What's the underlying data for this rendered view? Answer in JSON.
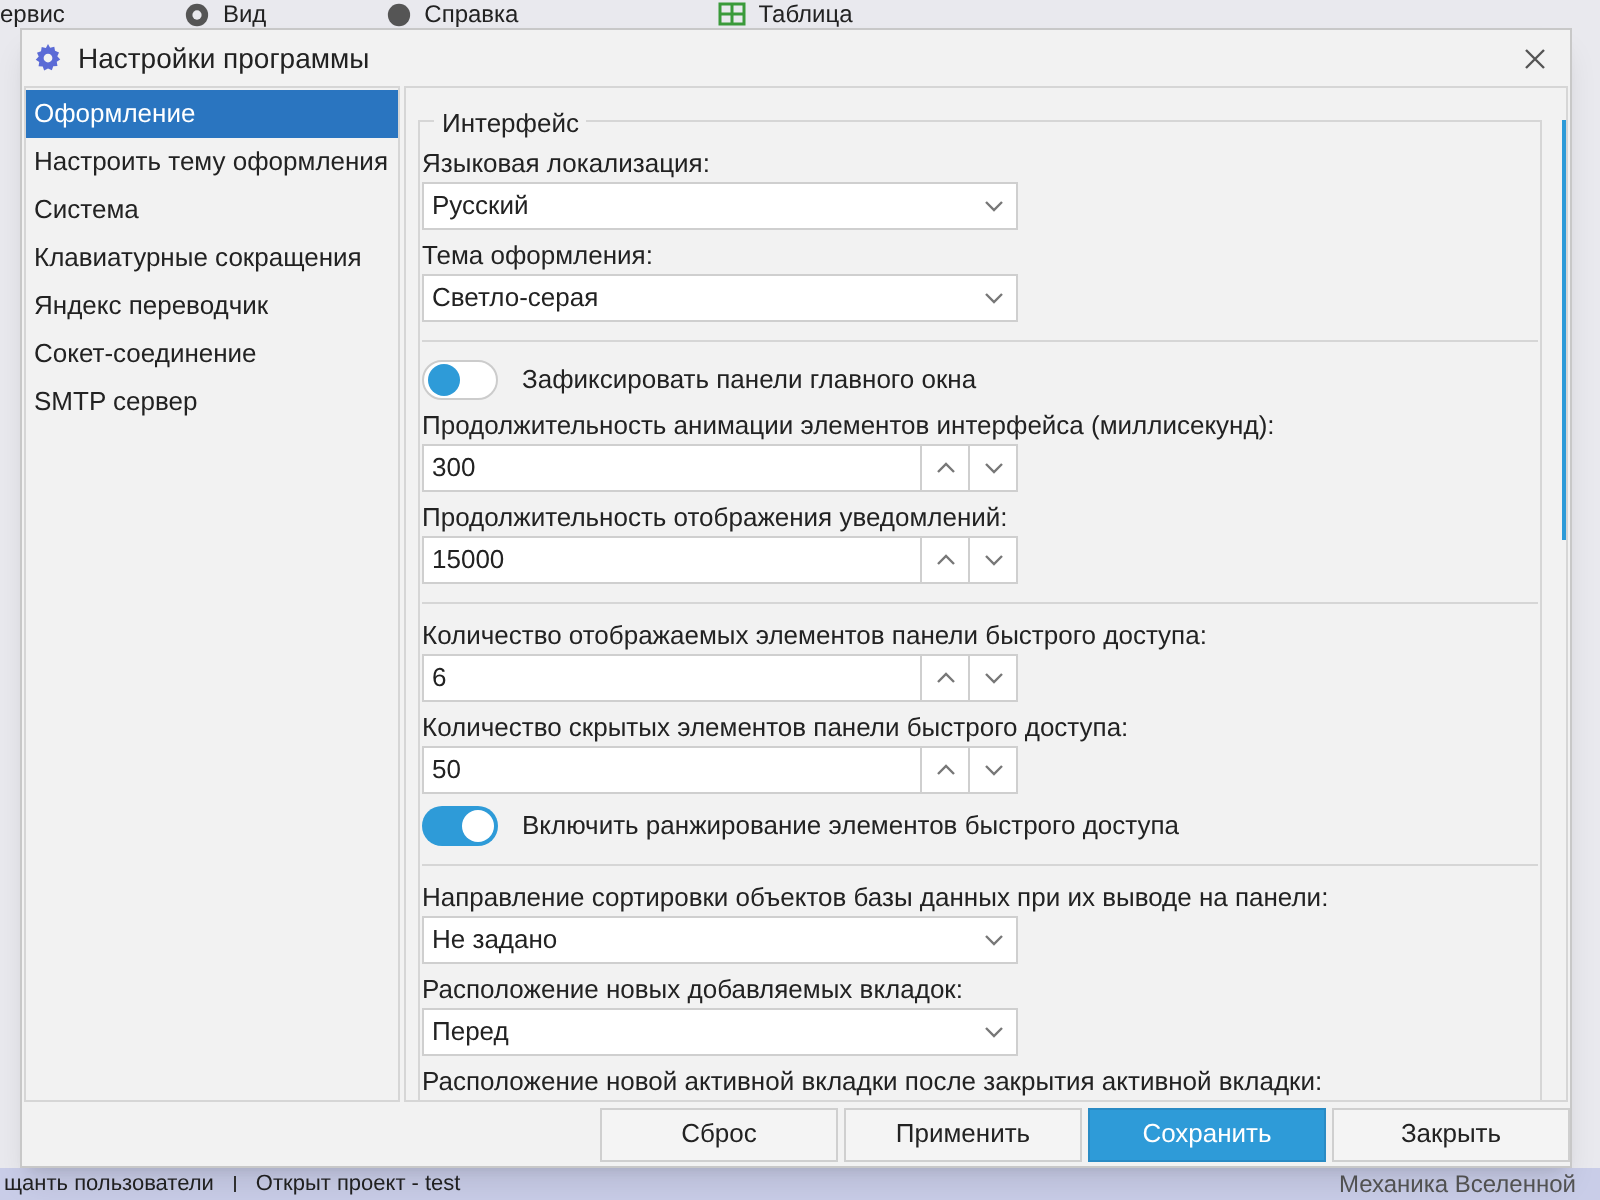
{
  "background_app": {
    "menu": [
      "ервис",
      "Вид",
      "Справка",
      "Таблица"
    ],
    "status_bar": [
      "щанть пользователи",
      "Открыт проект - test"
    ],
    "status_right": "Механика Вселенной"
  },
  "window": {
    "title": "Настройки программы"
  },
  "sidebar": {
    "items": [
      {
        "label": "Оформление",
        "selected": true
      },
      {
        "label": "Настроить тему оформления",
        "selected": false
      },
      {
        "label": "Система",
        "selected": false
      },
      {
        "label": "Клавиатурные сокращения",
        "selected": false
      },
      {
        "label": "Яндекс переводчик",
        "selected": false
      },
      {
        "label": "Сокет-соединение",
        "selected": false
      },
      {
        "label": "SMTP сервер",
        "selected": false
      }
    ]
  },
  "group": {
    "title": "Интерфейс",
    "settings": [
      {
        "kind": "select",
        "label": "Языковая локализация:",
        "value": "Русский"
      },
      {
        "kind": "select",
        "label": "Тема оформления:",
        "value": "Светло-серая"
      },
      {
        "kind": "separator"
      },
      {
        "kind": "toggle",
        "label": "Зафиксировать панели главного окна",
        "on": false
      },
      {
        "kind": "spin",
        "label": "Продолжительность анимации элементов интерфейса (миллисекунд):",
        "value": "300"
      },
      {
        "kind": "spin",
        "label": "Продолжительность отображения уведомлений:",
        "value": "15000"
      },
      {
        "kind": "separator"
      },
      {
        "kind": "spin",
        "label": "Количество отображаемых элементов панели быстрого доступа:",
        "value": "6"
      },
      {
        "kind": "spin",
        "label": "Количество скрытых элементов панели быстрого доступа:",
        "value": "50"
      },
      {
        "kind": "toggle",
        "label": "Включить ранжирование элементов быстрого доступа",
        "on": true
      },
      {
        "kind": "separator"
      },
      {
        "kind": "select",
        "label": "Направление сортировки объектов базы данных при их выводе на панели:",
        "value": "Не задано"
      },
      {
        "kind": "select",
        "label": "Расположение новых добавляемых вкладок:",
        "value": "Перед"
      },
      {
        "kind": "select",
        "label": "Расположение новой активной вкладки после закрытия активной вкладки:"
      }
    ]
  },
  "buttons": [
    {
      "label": "Сброс",
      "primary": false
    },
    {
      "label": "Применить",
      "primary": false
    },
    {
      "label": "Сохранить",
      "primary": true
    },
    {
      "label": "Закрыть",
      "primary": false
    }
  ]
}
